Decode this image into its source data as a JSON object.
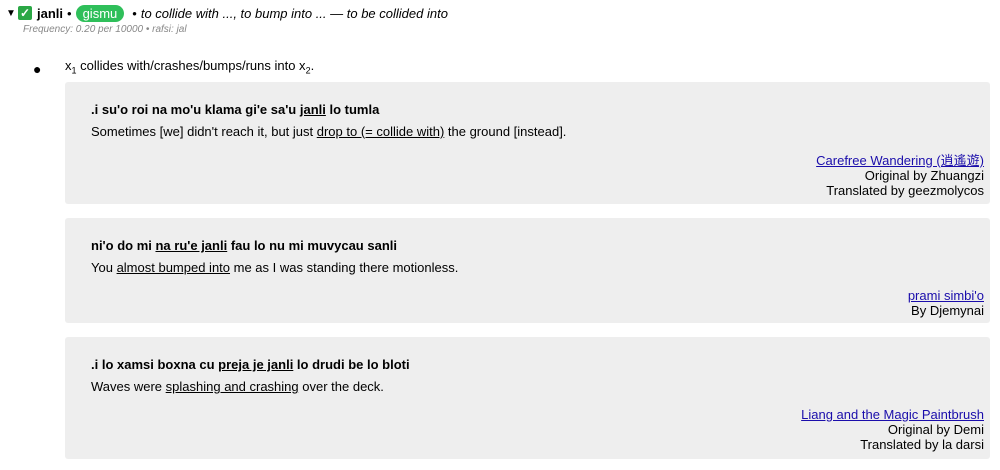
{
  "entry": {
    "word": "janli",
    "type_badge": "gismu",
    "separator": "•",
    "definitions": "to collide with ..., to bump into ... — to be collided into",
    "meta": "Frequency: 0.20 per 10000 • rafsi: jal"
  },
  "sense": {
    "place_pre": "x",
    "place_sub1": "1",
    "place_mid": " collides with/crashes/bumps/runs into x",
    "place_sub2": "2",
    "place_end": "."
  },
  "examples": [
    {
      "jbo_pre": ".i su'o roi na mo'u klama gi'e sa'u ",
      "jbo_u": "janli",
      "jbo_post": " lo tumla",
      "eng_pre": "Sometimes [we] didn't reach it, but just ",
      "eng_u": "drop to (= collide with)",
      "eng_post": " the ground [instead].",
      "source_title": "Carefree Wandering (逍遙遊)",
      "source_line2": "Original by Zhuangzi",
      "source_line3": "Translated by geezmolycos"
    },
    {
      "jbo_pre": "ni'o do mi ",
      "jbo_u": "na ru'e janli",
      "jbo_post": " fau lo nu mi muvycau sanli",
      "eng_pre": "You ",
      "eng_u": "almost bumped into",
      "eng_post": " me as I was standing there motionless.",
      "source_title": "prami simbi'o",
      "source_line2": "By Djemynai"
    },
    {
      "jbo_pre": ".i lo xamsi boxna cu ",
      "jbo_u": "preja je janli",
      "jbo_post": " lo drudi be lo bloti",
      "eng_pre": "Waves were ",
      "eng_u": "splashing and crashing",
      "eng_post": " over the deck.",
      "source_title": "Liang and the Magic Paintbrush",
      "source_line2": "Original by Demi",
      "source_line3": "Translated by la darsi"
    }
  ]
}
